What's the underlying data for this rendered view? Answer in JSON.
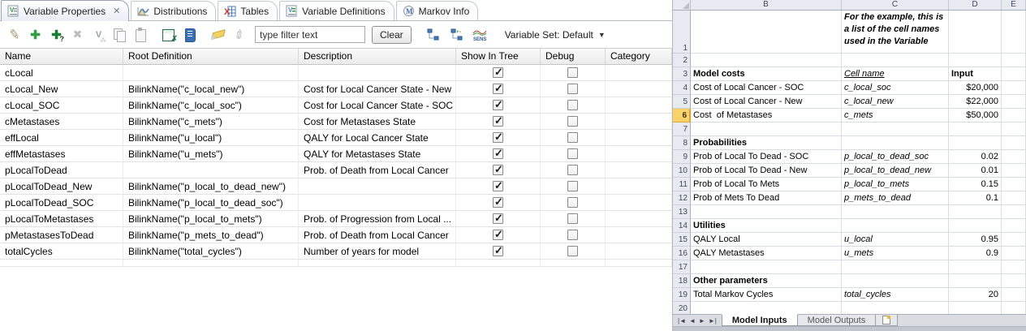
{
  "colors": {
    "selection_gold": "#f9d26a",
    "excel_gridline": "#d6dde6",
    "excel_header_bg": "#e7ebf1",
    "active_tab_gradient_bottom": "#e9eef5",
    "add_icon_green": "#2f9e44",
    "report_icon_blue": "#3b6fb5"
  },
  "left_panel": {
    "tabs": [
      {
        "label": "Variable Properties",
        "active": true,
        "closable": true
      },
      {
        "label": "Distributions",
        "active": false
      },
      {
        "label": "Tables",
        "active": false
      },
      {
        "label": "Variable Definitions",
        "active": false
      },
      {
        "label": "Markov Info",
        "active": false
      }
    ],
    "toolbar": {
      "icon_names": [
        "edit-pencil-icon",
        "add-variable-icon",
        "add-variable-question-icon",
        "delete-icon",
        "rename-variable-icon",
        "copy-icon",
        "paste-icon",
        "export-excel-icon",
        "report-icon",
        "highlighter-icon",
        "filter-pin-icon"
      ],
      "tree_icon_names": [
        "flat-view-icon",
        "tree-view-plus-minus-icon",
        "sensitivity-sens-icon"
      ],
      "filter_value": "type filter text",
      "clear_label": "Clear",
      "variable_set_label": "Variable Set: Default"
    },
    "table": {
      "columns": [
        "Name",
        "Root Definition",
        "Description",
        "Show In Tree",
        "Debug",
        "Category"
      ],
      "rows": [
        {
          "name": "cLocal",
          "root_definition": "",
          "description": "",
          "show_in_tree": true,
          "debug": false,
          "category": ""
        },
        {
          "name": "cLocal_New",
          "root_definition": "BilinkName(\"c_local_new\")",
          "description": "Cost for Local Cancer State - New",
          "show_in_tree": true,
          "debug": false,
          "category": ""
        },
        {
          "name": "cLocal_SOC",
          "root_definition": "BilinkName(\"c_local_soc\")",
          "description": "Cost for Local Cancer State - SOC",
          "show_in_tree": true,
          "debug": false,
          "category": ""
        },
        {
          "name": "cMetastases",
          "root_definition": "BilinkName(\"c_mets\")",
          "description": "Cost for Metastases State",
          "show_in_tree": true,
          "debug": false,
          "category": ""
        },
        {
          "name": "effLocal",
          "root_definition": "BilinkName(\"u_local\")",
          "description": "QALY for Local Cancer State",
          "show_in_tree": true,
          "debug": false,
          "category": ""
        },
        {
          "name": "effMetastases",
          "root_definition": "BilinkName(\"u_mets\")",
          "description": "QALY for Metastases State",
          "show_in_tree": true,
          "debug": false,
          "category": ""
        },
        {
          "name": "pLocalToDead",
          "root_definition": "",
          "description": "Prob. of Death from Local Cancer",
          "show_in_tree": true,
          "debug": false,
          "category": ""
        },
        {
          "name": "pLocalToDead_New",
          "root_definition": "BilinkName(\"p_local_to_dead_new\")",
          "description": "",
          "show_in_tree": true,
          "debug": false,
          "category": ""
        },
        {
          "name": "pLocalToDead_SOC",
          "root_definition": "BilinkName(\"p_local_to_dead_soc\")",
          "description": "",
          "show_in_tree": true,
          "debug": false,
          "category": ""
        },
        {
          "name": "pLocalToMetastases",
          "root_definition": "BilinkName(\"p_local_to_mets\")",
          "description": "Prob. of Progression from Local ...",
          "show_in_tree": true,
          "debug": false,
          "category": ""
        },
        {
          "name": "pMetastasesToDead",
          "root_definition": "BilinkName(\"p_mets_to_dead\")",
          "description": "Prob. of Death from Local Cancer",
          "show_in_tree": true,
          "debug": false,
          "category": ""
        },
        {
          "name": "totalCycles",
          "root_definition": "BilinkName(\"total_cycles\")",
          "description": "Number of years for model",
          "show_in_tree": true,
          "debug": false,
          "category": ""
        }
      ]
    }
  },
  "spreadsheet": {
    "column_headers": [
      "B",
      "C",
      "D",
      "E"
    ],
    "selected_row": 6,
    "rows": [
      {
        "n": 1,
        "c": "For the example, this is\na list of the cell names\nused in the Variable",
        "note": true,
        "tall": true
      },
      {
        "n": 2
      },
      {
        "n": 3,
        "b": "Model costs",
        "c": "Cell name",
        "d": "Input",
        "section": true,
        "c_underline": true,
        "d_bold": true
      },
      {
        "n": 4,
        "b": "Cost of Local Cancer - SOC",
        "c": "c_local_soc",
        "d": "$20,000"
      },
      {
        "n": 5,
        "b": "Cost of Local Cancer - New",
        "c": "c_local_new",
        "d": "$22,000"
      },
      {
        "n": 6,
        "b": "Cost  of Metastases",
        "c": "c_mets",
        "d": "$50,000",
        "selected": true
      },
      {
        "n": 7
      },
      {
        "n": 8,
        "b": "Probabilities",
        "section": true
      },
      {
        "n": 9,
        "b": "Prob of Local To Dead - SOC",
        "c": "p_local_to_dead_soc",
        "d": "0.02"
      },
      {
        "n": 10,
        "b": "Prob of Local To Dead - New",
        "c": "p_local_to_dead_new",
        "d": "0.01"
      },
      {
        "n": 11,
        "b": "Prob of Local To Mets",
        "c": "p_local_to_mets",
        "d": "0.15"
      },
      {
        "n": 12,
        "b": "Prob of Mets To Dead",
        "c": "p_mets_to_dead",
        "d": "0.1"
      },
      {
        "n": 13
      },
      {
        "n": 14,
        "b": "Utilities",
        "section": true
      },
      {
        "n": 15,
        "b": "QALY Local",
        "c": "u_local",
        "d": "0.95"
      },
      {
        "n": 16,
        "b": "QALY Metastases",
        "c": "u_mets",
        "d": "0.9"
      },
      {
        "n": 17
      },
      {
        "n": 18,
        "b": "Other parameters",
        "section": true
      },
      {
        "n": 19,
        "b": "Total Markov Cycles",
        "c": "total_cycles",
        "d": "20"
      },
      {
        "n": 20
      }
    ],
    "sheet_tabs": [
      {
        "label": "Model Inputs",
        "active": true
      },
      {
        "label": "Model Outputs",
        "active": false
      }
    ]
  }
}
